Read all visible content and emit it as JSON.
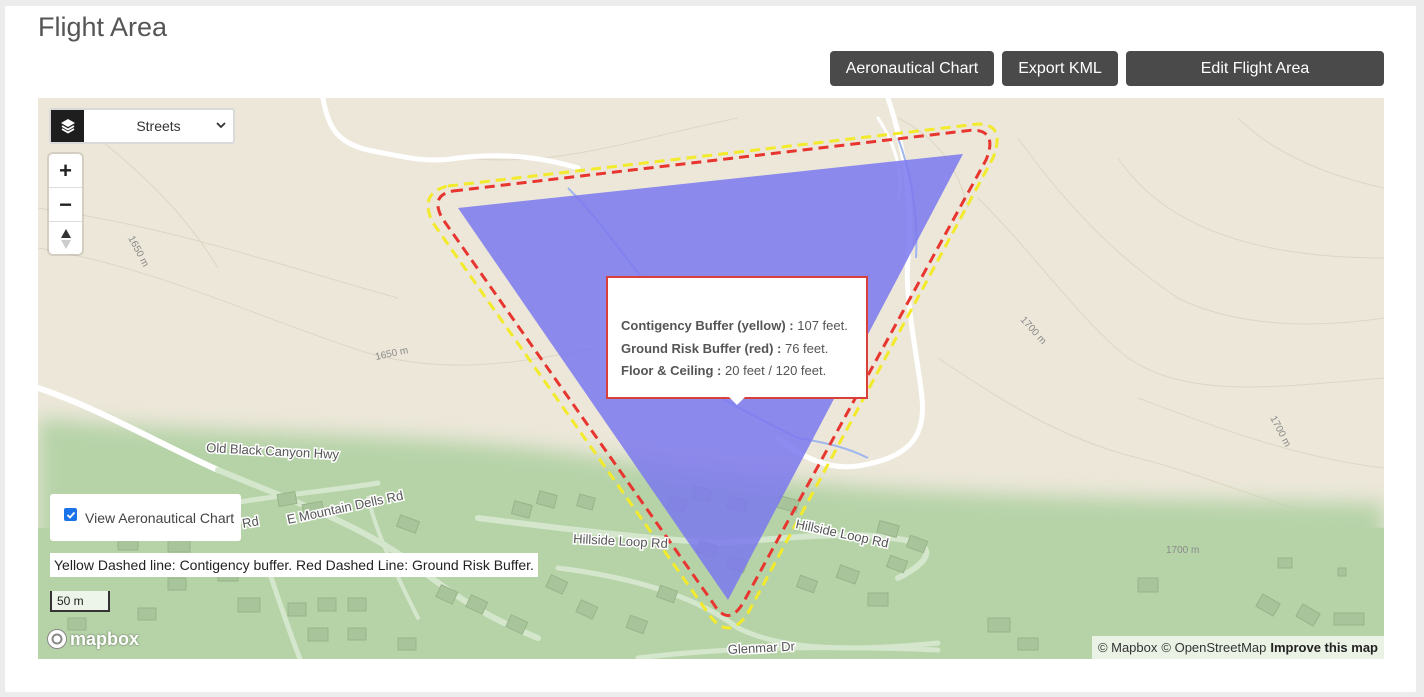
{
  "page": {
    "title": "Flight Area"
  },
  "toolbar": {
    "aeronautical_chart_label": "Aeronautical Chart",
    "export_kml_label": "Export KML",
    "edit_flight_area_label": "Edit Flight Area"
  },
  "map": {
    "layer_select": {
      "selected": "Streets",
      "icon": "layers-icon"
    },
    "zoom": {
      "in_label": "+",
      "out_label": "−",
      "compass_icon": "compass-icon"
    },
    "labels": {
      "contour_1650_a": "1650 m",
      "contour_1650_b": "1650 m",
      "contour_1700_a": "1700 m",
      "contour_1700_b": "1700 m",
      "contour_1700_c": "1700 m",
      "road_old_black_canyon": "Old Black Canyon Hwy",
      "road_e_mountain_dells": "E Mountain Dells Rd",
      "road_rd_fragment": "Rd",
      "road_hillside_loop_a": "Hillside Loop Rd",
      "road_hillside_loop_b": "Hillside Loop Rd",
      "road_glenmar": "Glenmar Dr"
    },
    "popup": {
      "contingency_label": "Contigency Buffer (yellow) :",
      "contingency_value": "107 feet.",
      "ground_risk_label": "Ground Risk Buffer (red) :",
      "ground_risk_value": "76 feet.",
      "floor_ceiling_label": "Floor & Ceiling :",
      "floor_ceiling_value": "20 feet / 120 feet."
    },
    "view_chart_toggle": {
      "label": "View Aeronautical Chart",
      "checked": true
    },
    "legend_text": "Yellow Dashed line: Contigency buffer. Red Dashed Line: Ground Risk Buffer.",
    "scale_text": "50 m",
    "logo_text": "mapbox",
    "attribution": {
      "mapbox": "© Mapbox",
      "osm": "© OpenStreetMap",
      "improve": "Improve this map"
    },
    "colors": {
      "flight_area_fill": "#7b78ee",
      "contingency_buffer": "#f2ea2a",
      "ground_risk_buffer": "#e8352f",
      "terrain": "#ece7d9",
      "vegetation": "#b6d3a8"
    }
  }
}
